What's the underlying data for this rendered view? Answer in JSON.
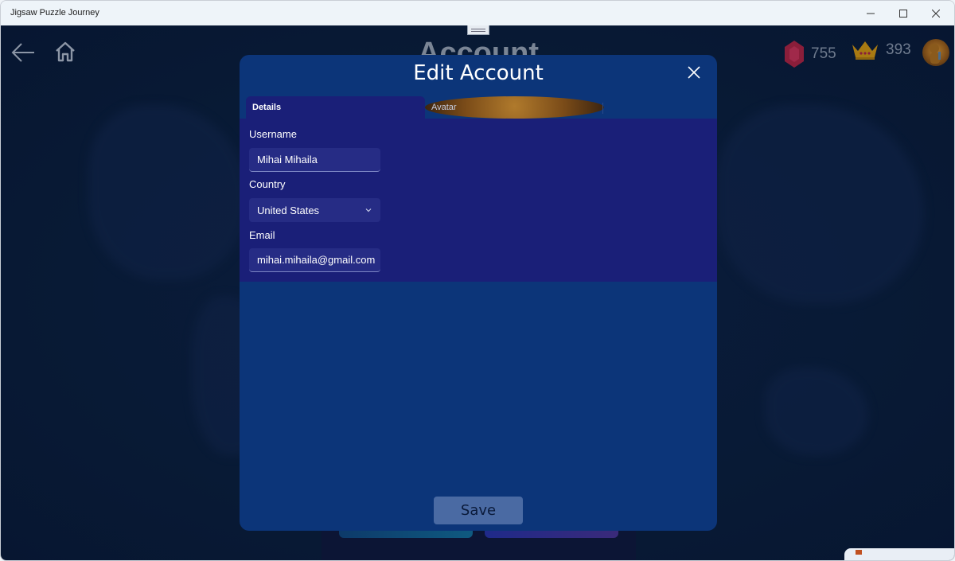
{
  "window": {
    "title": "Jigsaw Puzzle Journey",
    "controls": {
      "minimize": "minimize",
      "maximize": "maximize",
      "close": "close"
    }
  },
  "header": {
    "page_title": "Account",
    "back_icon": "arrow-left-icon",
    "home_icon": "home-icon",
    "gems": {
      "icon": "gem-icon",
      "value": "755",
      "color": "#c8324e"
    },
    "crowns": {
      "icon": "crown-icon",
      "value": "393",
      "color": "#d9a320"
    },
    "avatar_icon": "avatar-icon"
  },
  "dialog": {
    "title": "Edit Account",
    "close_icon": "close-icon",
    "tabs": [
      {
        "label": "Details",
        "selected": true
      },
      {
        "label": "Avatar",
        "selected": false
      }
    ],
    "fields": {
      "username": {
        "label": "Username",
        "value": "Mihai Mihaila"
      },
      "country": {
        "label": "Country",
        "value": "United States"
      },
      "email": {
        "label": "Email",
        "value": "mihai.mihaila@gmail.com"
      }
    },
    "save_label": "Save"
  },
  "colors": {
    "dialog_bg": "#0c3579",
    "panel_bg": "#1a1f78",
    "save_bg": "#4a6aa3"
  }
}
